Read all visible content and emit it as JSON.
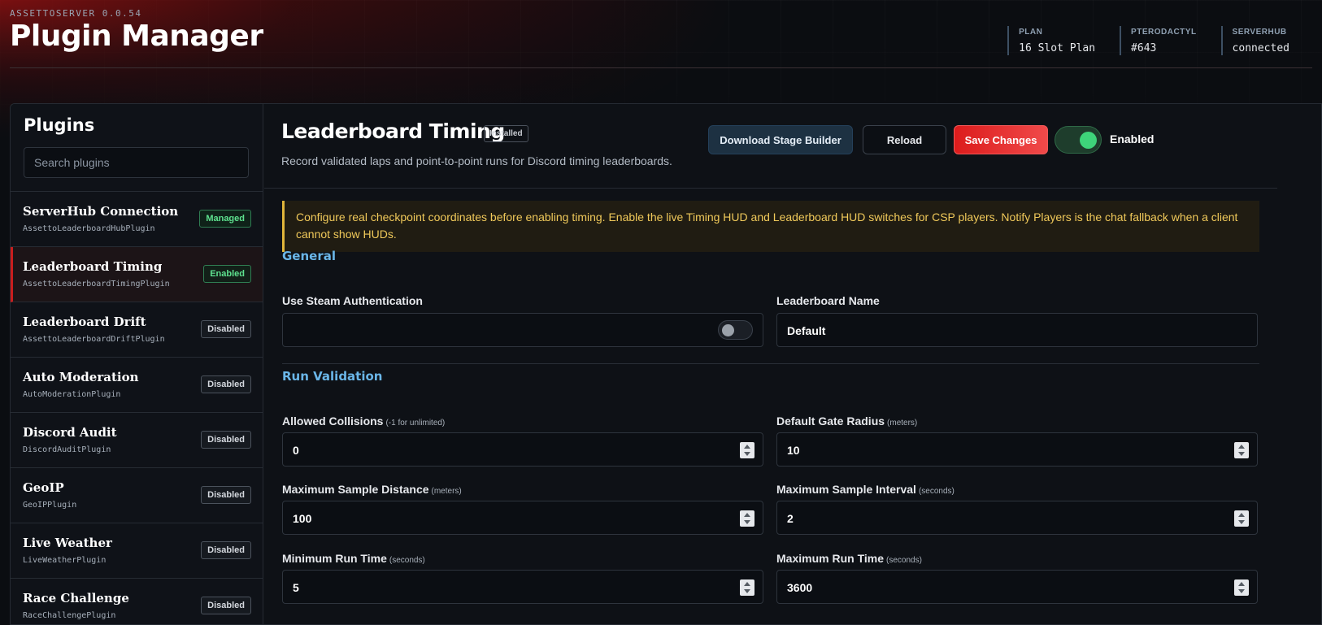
{
  "header": {
    "subtitle": "ASSETTOSERVER 0.0.54",
    "title": "Plugin Manager",
    "stats": [
      {
        "label": "PLAN",
        "value": "16 Slot Plan"
      },
      {
        "label": "PTERODACTYL",
        "value": "#643"
      },
      {
        "label": "SERVERHUB",
        "value": "connected"
      }
    ]
  },
  "sidebar": {
    "title": "Plugins",
    "search_placeholder": "Search plugins",
    "items": [
      {
        "name": "ServerHub Connection",
        "class": "AssettoLeaderboardHubPlugin",
        "status": "Managed"
      },
      {
        "name": "Leaderboard Timing",
        "class": "AssettoLeaderboardTimingPlugin",
        "status": "Enabled"
      },
      {
        "name": "Leaderboard Drift",
        "class": "AssettoLeaderboardDriftPlugin",
        "status": "Disabled"
      },
      {
        "name": "Auto Moderation",
        "class": "AutoModerationPlugin",
        "status": "Disabled"
      },
      {
        "name": "Discord Audit",
        "class": "DiscordAuditPlugin",
        "status": "Disabled"
      },
      {
        "name": "GeoIP",
        "class": "GeoIPPlugin",
        "status": "Disabled"
      },
      {
        "name": "Live Weather",
        "class": "LiveWeatherPlugin",
        "status": "Disabled"
      },
      {
        "name": "Race Challenge",
        "class": "RaceChallengePlugin",
        "status": "Disabled"
      }
    ],
    "active_item": "Leaderboard Timing"
  },
  "main": {
    "title": "Leaderboard Timing",
    "installed_badge": "Installed",
    "description": "Record validated laps and point-to-point runs for Discord timing leaderboards.",
    "buttons": {
      "download": "Download Stage Builder",
      "reload": "Reload",
      "save": "Save Changes"
    },
    "enabled_toggle": {
      "label": "Enabled",
      "on": true
    },
    "alert": "Configure real checkpoint coordinates before enabling timing. Enable the live Timing HUD and Leaderboard HUD switches for CSP players. Notify Players is the chat fallback when a client cannot show HUDs.",
    "sections": {
      "general": {
        "title": "General",
        "use_steam_auth": {
          "label": "Use Steam Authentication",
          "on": false
        },
        "leaderboard_name": {
          "label": "Leaderboard Name",
          "value": "Default"
        }
      },
      "run_validation": {
        "title": "Run Validation",
        "allowed_collisions": {
          "label": "Allowed Collisions",
          "hint": "(-1 for unlimited)",
          "value": "0"
        },
        "default_gate_radius": {
          "label": "Default Gate Radius",
          "hint": "(meters)",
          "value": "10"
        },
        "max_sample_distance": {
          "label": "Maximum Sample Distance",
          "hint": "(meters)",
          "value": "100"
        },
        "max_sample_interval": {
          "label": "Maximum Sample Interval",
          "hint": "(seconds)",
          "value": "2"
        },
        "min_run_time": {
          "label": "Minimum Run Time",
          "hint": "(seconds)",
          "value": "5"
        },
        "max_run_time": {
          "label": "Maximum Run Time",
          "hint": "(seconds)",
          "value": "3600"
        }
      }
    }
  },
  "colors": {
    "accent_red": "#dc1c1c",
    "success_green": "#3ed47a",
    "section_blue": "#6ab6e8",
    "alert_yellow": "#f0c95a"
  }
}
